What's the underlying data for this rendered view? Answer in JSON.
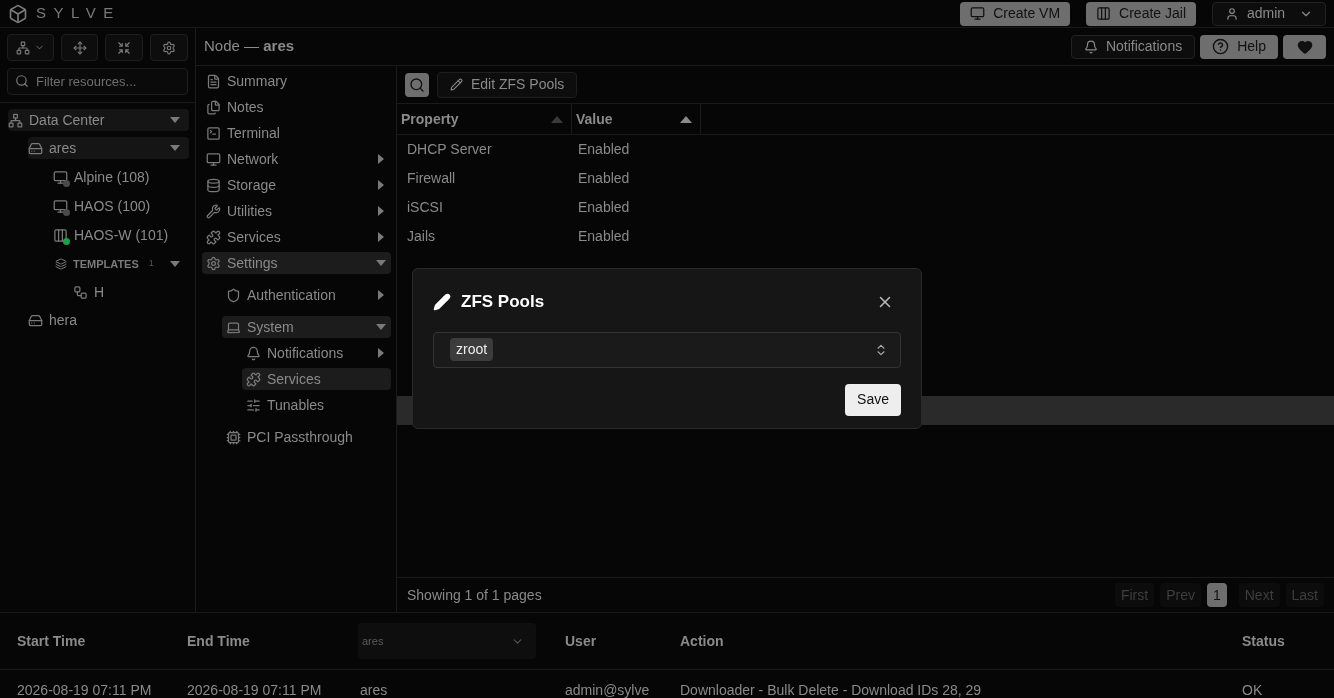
{
  "header": {
    "logo_text": "SYLVE",
    "buttons": [
      "Create VM",
      "Create Jail"
    ],
    "user": "admin"
  },
  "toolbar": {
    "breadcrumb": "Node — **ares**",
    "notifications": "Notifications",
    "help": "Help"
  },
  "filter": {
    "placeholder": "Filter resources..."
  },
  "tree": [
    {
      "kind": "datacenter",
      "label": "Data Center",
      "expanded": true,
      "children": [
        {
          "kind": "node",
          "label": "ares",
          "expanded": true,
          "children": [
            {
              "kind": "vm",
              "label": "Alpine (108)",
              "color": "#4a4a4a"
            },
            {
              "kind": "vm",
              "label": "HAOS (100)",
              "color": "#4a4a4a"
            },
            {
              "kind": "jail",
              "label": "HAOS-W (101)",
              "color": "#16a34a"
            },
            {
              "kind": "templates",
              "label": "TEMPLATES",
              "count": "1",
              "expanded": true,
              "children": [
                {
                  "kind": "template",
                  "label": "H"
                }
              ]
            }
          ]
        },
        {
          "kind": "node",
          "label": "hera"
        }
      ]
    }
  ],
  "nav": [
    {
      "label": "Summary"
    },
    {
      "label": "Notes"
    },
    {
      "label": "Terminal"
    },
    {
      "label": "Network",
      "expanded": false
    },
    {
      "label": "Storage",
      "expanded": false
    },
    {
      "label": "Utilities",
      "expanded": false
    },
    {
      "label": "Services",
      "expanded": false
    },
    {
      "label": "Settings",
      "expanded": true,
      "children": [
        {
          "label": "Authentication",
          "expanded": false
        },
        {
          "label": "System",
          "expanded": true,
          "children": [
            {
              "label": "Notifications",
              "expanded": false
            },
            {
              "label": "Services",
              "selected": true
            },
            {
              "label": "Tunables",
              "selected": false
            }
          ]
        },
        {
          "label": "PCI Passthrough"
        }
      ]
    }
  ],
  "table": {
    "edit_button": "Edit ZFS Pools",
    "columns": [
      "Property",
      "Value"
    ],
    "rows": [
      {
        "property": "DHCP Server",
        "value": "Enabled",
        "selected": false
      },
      {
        "property": "Firewall",
        "value": "Enabled",
        "selected": false
      },
      {
        "property": "iSCSI",
        "value": "Enabled",
        "selected": false
      },
      {
        "property": "Jails",
        "value": "Enabled",
        "selected": false
      },
      {
        "selected": false
      },
      {
        "selected": false
      },
      {
        "selected": false
      },
      {
        "selected": false
      },
      {
        "selected": false
      },
      {
        "selected": true
      }
    ],
    "footer": "Showing 1 of 1 pages",
    "pages": [
      {
        "label": "First",
        "disabled": true
      },
      {
        "label": "Prev",
        "disabled": true
      },
      {
        "label": "1",
        "selected": true
      },
      {
        "label": "Next",
        "disabled": true
      },
      {
        "label": "Last",
        "disabled": true
      }
    ]
  },
  "audit": {
    "columns": [
      "Start Time",
      "End Time",
      "User",
      "Action",
      "Status"
    ],
    "filter_value": "ares",
    "rows": [
      {
        "start": "2026-08-19 07:11 PM",
        "end": "2026-08-19 07:11 PM",
        "node": "ares",
        "user": "admin@sylve",
        "action": "Downloader - Bulk Delete - Download IDs 28, 29",
        "status": "OK"
      }
    ]
  },
  "modal": {
    "title": "ZFS Pools",
    "tags": [
      "zroot"
    ],
    "save": "Save"
  }
}
